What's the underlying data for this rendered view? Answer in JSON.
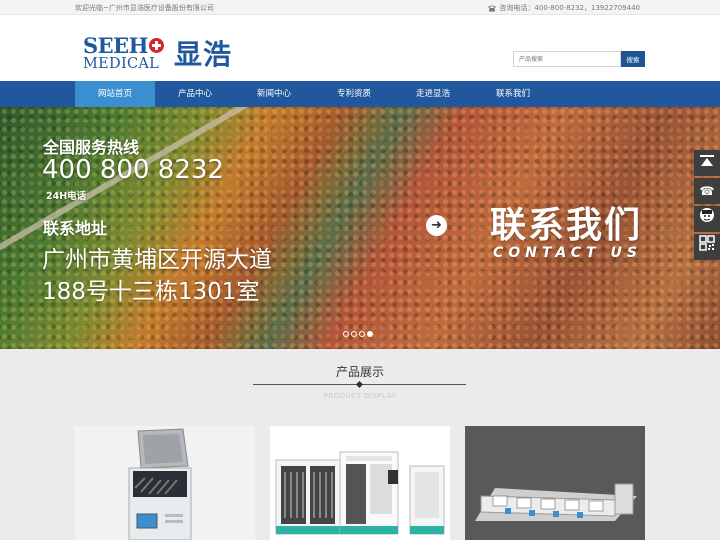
{
  "topbar": {
    "welcome": "欢迎光临~广州市显浩医疗设备股份有限公司",
    "hotline": "咨询电话：400-800-8232，13922709440"
  },
  "logo": {
    "seeh": "SEEH",
    "medical": "MEDICAL",
    "cn": "显浩"
  },
  "search": {
    "placeholder": "产品搜索",
    "button": "搜索"
  },
  "nav": {
    "items": [
      {
        "label": "网站首页",
        "active": true
      },
      {
        "label": "产品中心",
        "active": false
      },
      {
        "label": "新闻中心",
        "active": false
      },
      {
        "label": "专利资质",
        "active": false
      },
      {
        "label": "走进显浩",
        "active": false
      },
      {
        "label": "联系我们",
        "active": false
      }
    ]
  },
  "banner": {
    "hotline_title": "全国服务热线",
    "phone": "400 800 8232",
    "hours": "24H电话",
    "address_title": "联系地址",
    "address_line1": "广州市黄埔区开源大道",
    "address_line2": "188号十三栋1301室",
    "contact_cn": "联系我们",
    "contact_en": "CONTACT US",
    "slides": 4,
    "active_slide": 4
  },
  "side_buttons": [
    "top-icon",
    "phone-icon",
    "support-icon",
    "qr-code-icon"
  ],
  "products": {
    "title": "产品展示",
    "subtitle": "PRODUCT DISPLAY"
  },
  "colors": {
    "brand_blue": "#21579d",
    "nav_active": "#3b8fd1",
    "logo_red": "#d6262b"
  }
}
